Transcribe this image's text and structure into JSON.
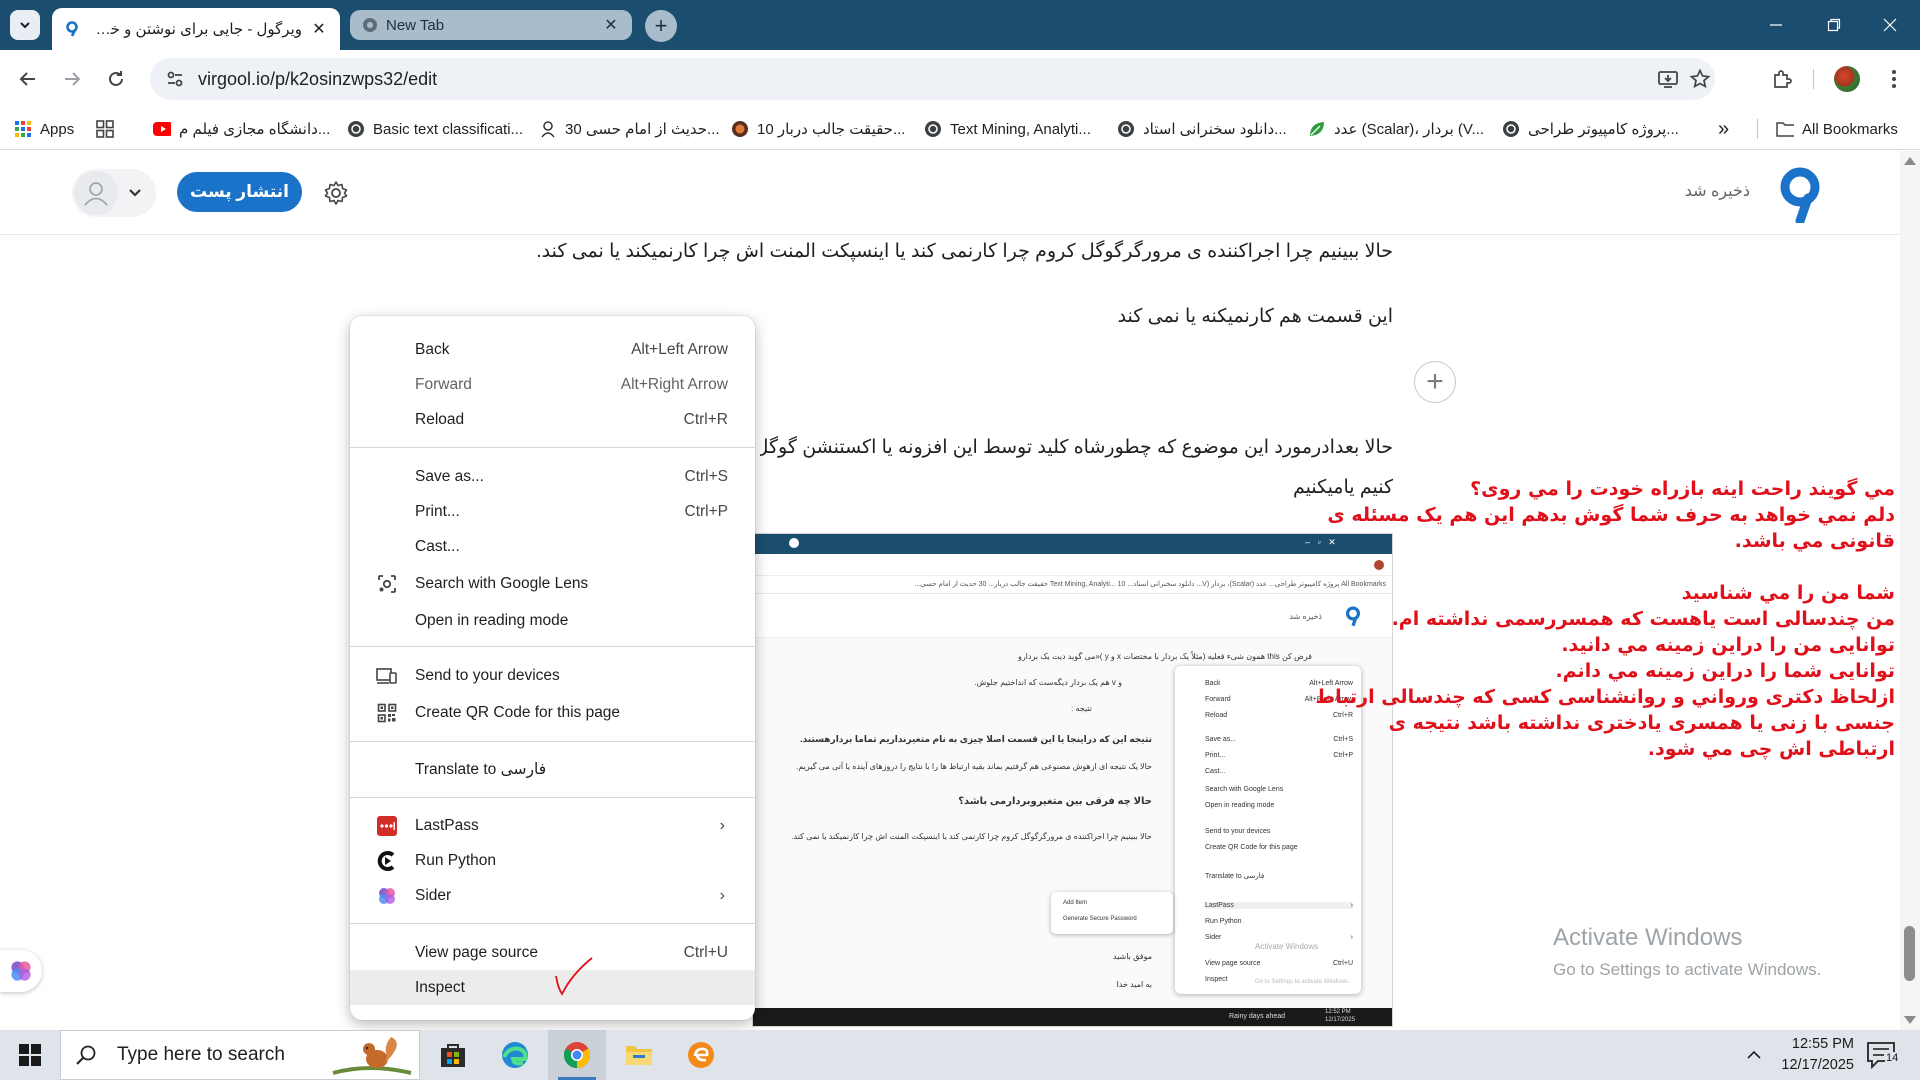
{
  "browser": {
    "tabs": [
      {
        "title": "ویرگول - جایی برای نوشتن و خواندن",
        "active": true
      },
      {
        "title": "New Tab",
        "active": false
      }
    ],
    "url": "virgool.io/p/k2osinzwps32/edit",
    "bookmarks": [
      {
        "label": "Apps",
        "icon": "apps-grid-icon"
      },
      {
        "label": "",
        "icon": "tab-groups-icon"
      },
      {
        "label": "دانشگاه مجازی فیلم م...",
        "icon": "youtube-icon"
      },
      {
        "label": "Basic text classificati...",
        "icon": "globe-icon"
      },
      {
        "label": "30 حدیث از امام حسی...",
        "icon": "figure-icon"
      },
      {
        "label": "10 حقیقت جالب دربار...",
        "icon": "planet-icon"
      },
      {
        "label": "Text Mining, Analyti...",
        "icon": "globe-icon"
      },
      {
        "label": "دانلود سخنرانی استاد...",
        "icon": "globe-icon"
      },
      {
        "label": "عدد (Scalar)، بردار (V...",
        "icon": "leaf-icon"
      },
      {
        "label": "پروژه کامپیوتر طراحی...",
        "icon": "globe-icon"
      }
    ],
    "more_bookmarks": "»",
    "all_bookmarks": "All Bookmarks"
  },
  "site": {
    "publish_label": "انتشار پست",
    "saved_status": "ذخیره شد"
  },
  "article": {
    "p1": "حالا ببینیم چرا اجراکننده ی مرورگرگوگل کروم چرا کارنمی کند یا اینسپکت المنت اش چرا کارنمیکند یا نمی کند.",
    "p2": "این قسمت هم کارنمیکنه یا نمی کند",
    "p3": "حالا بعدادرمورد این موضوع که چطورشاه کلید توسط این افزونه یا اکستنشن گوگل کروم را باز",
    "p4": "کنیم یامیکنیم"
  },
  "note": {
    "lines": [
      "مي گويند راحت اينه بازراه خودت را مي روی؟",
      "دلم نمي خواهد به حرف شما گوش بدهم اين هم يک مسئله ی",
      "قانونی مي باشد.",
      "",
      "شما من را مي شناسيد",
      "من چندسالی است ياهست كه همسررسمی نداشته ام.",
      "توانايی من را دراين زمينه  مي دانيد.",
      "توانايی شما را دراين زمينه مي دانم.",
      "ازلحاظ دكتری ورواني و روانشناسی كسی كه چندسالی ارتباط",
      "جنسی با زنی يا همسری يادختری نداشته باشد نتيجه ی",
      "ارتباطی اش چی مي شود."
    ]
  },
  "context_menu": {
    "groups": [
      [
        {
          "label": "Back",
          "shortcut": "Alt+Left Arrow",
          "icon": "",
          "disabled": false
        },
        {
          "label": "Forward",
          "shortcut": "Alt+Right Arrow",
          "icon": "",
          "disabled": true
        },
        {
          "label": "Reload",
          "shortcut": "Ctrl+R",
          "icon": "",
          "disabled": false
        }
      ],
      [
        {
          "label": "Save as...",
          "shortcut": "Ctrl+S",
          "icon": ""
        },
        {
          "label": "Print...",
          "shortcut": "Ctrl+P",
          "icon": ""
        },
        {
          "label": "Cast...",
          "shortcut": "",
          "icon": ""
        },
        {
          "label": "Search with Google Lens",
          "shortcut": "",
          "icon": "google-lens-icon"
        },
        {
          "label": "Open in reading mode",
          "shortcut": "",
          "icon": ""
        }
      ],
      [
        {
          "label": "Send to your devices",
          "shortcut": "",
          "icon": "devices-icon"
        },
        {
          "label": "Create QR Code for this page",
          "shortcut": "",
          "icon": "qr-code-icon"
        }
      ],
      [
        {
          "label": "Translate to فارسی",
          "shortcut": "",
          "icon": ""
        }
      ],
      [
        {
          "label": "LastPass",
          "shortcut": "",
          "icon": "lastpass-icon",
          "submenu": true
        },
        {
          "label": "Run Python",
          "shortcut": "",
          "icon": "run-python-icon"
        },
        {
          "label": "Sider",
          "shortcut": "",
          "icon": "sider-icon",
          "submenu": true
        }
      ],
      [
        {
          "label": "View page source",
          "shortcut": "Ctrl+U",
          "icon": ""
        },
        {
          "label": "Inspect",
          "shortcut": "",
          "icon": "",
          "hover": true
        }
      ]
    ]
  },
  "embedded_screenshot": {
    "bookmarks_text": "All Bookmarks   پروژه کامپیوتر طراحی...   عدد (Scalar)، بردار (V...   دانلود سخنرانی استاد...   Text Mining, Analyti...   10 حقیقت جالب دربار...   30 حدیث از امام حسی...",
    "saved": "ذخیره شد",
    "lines": [
      "فرض کن  this  همون شیء فعلیه (مثلاً یک بردار با مختصات  x  و  y )«می گوید دیت یک بردارو",
      "و  v  هم یک بردار دیگه‌ست که انداختیم جلوش.",
      "نتیجه :",
      "نتیجه این که دراینجا یا این قسمت اصلا چیزی به نام متغیرنداریم تماما بردارهستند.",
      "حالا یک نتیجه ای ازهوش مصنوعی هم گرفتیم بماند بقیه ارتباط ها را با نتایج را دروزهای آینده یا آتی می گیریم.",
      "حالا چه فرقی بین متغیروبردارمی باشد؟",
      "حالا ببینیم چرا اجراکننده ی مرورگرگوگل کروم چرا کارنمی کند یا اینسپکت المنت اش چرا کارنمیکند یا نمی کند.",
      "موفق باشید",
      "به امید خدا"
    ],
    "menu": [
      [
        "Back",
        "Alt+Left Arrow"
      ],
      [
        "Forward",
        "Alt+Right Arrow"
      ],
      [
        "Reload",
        "Ctrl+R"
      ],
      [
        "Save as...",
        "Ctrl+S"
      ],
      [
        "Print...",
        "Ctrl+P"
      ],
      [
        "Cast...",
        ""
      ],
      [
        "Search with Google Lens",
        ""
      ],
      [
        "Open in reading mode",
        ""
      ],
      [
        "Send to your devices",
        ""
      ],
      [
        "Create QR Code for this page",
        ""
      ],
      [
        "Translate to فارسی",
        ""
      ],
      [
        "LastPass",
        "›"
      ],
      [
        "Run Python",
        ""
      ],
      [
        "Sider",
        "›"
      ],
      [
        "View page source",
        "Ctrl+U"
      ],
      [
        "Inspect",
        ""
      ]
    ],
    "submenu": [
      "Add Item",
      "Generate Secure Password"
    ],
    "watermark": "Activate Windows",
    "watermark_sub": "Go to Settings to activate Windows.",
    "weather": "Rainy days ahead",
    "time": "12:52 PM",
    "date": "12/17/2025"
  },
  "activation": {
    "title": "Activate Windows",
    "subtitle": "Go to Settings to activate Windows."
  },
  "taskbar": {
    "search_placeholder": "Type here to search",
    "time": "12:55 PM",
    "date": "12/17/2025",
    "notifications": "14"
  },
  "colors": {
    "tabstrip": "#1b4d6e",
    "publish": "#1a73c8",
    "note_red": "#e0101a"
  }
}
